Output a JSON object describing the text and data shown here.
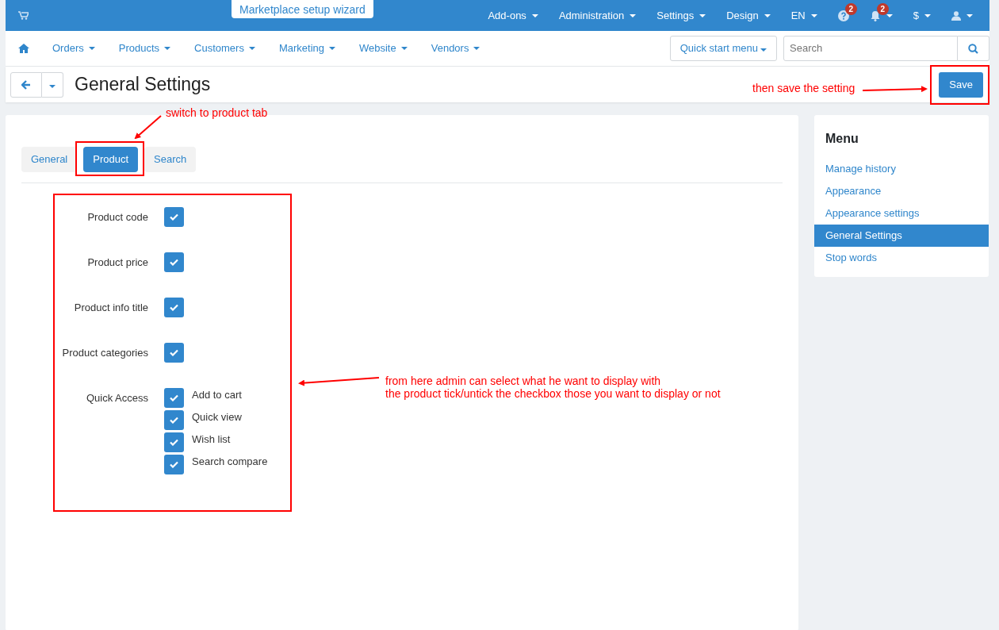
{
  "top_bar": {
    "wizard": "Marketplace setup wizard",
    "items": [
      {
        "kind": "text",
        "label": "Add-ons",
        "caret": true
      },
      {
        "kind": "text",
        "label": "Administration",
        "caret": true
      },
      {
        "kind": "text",
        "label": "Settings",
        "caret": true
      },
      {
        "kind": "text",
        "label": "Design",
        "caret": true
      },
      {
        "kind": "text",
        "label": "EN",
        "caret": true
      },
      {
        "kind": "help",
        "badge": "2",
        "caret": false
      },
      {
        "kind": "bell",
        "badge": "2",
        "caret": true
      },
      {
        "kind": "text",
        "label": "$",
        "caret": true
      },
      {
        "kind": "user",
        "caret": true
      }
    ]
  },
  "nav": {
    "items": [
      {
        "label": "Orders"
      },
      {
        "label": "Products"
      },
      {
        "label": "Customers"
      },
      {
        "label": "Marketing"
      },
      {
        "label": "Website"
      },
      {
        "label": "Vendors"
      }
    ],
    "quick_start": "Quick start menu",
    "search": {
      "placeholder": "Search"
    }
  },
  "page_title": "General Settings",
  "save_button": "Save",
  "tabs": [
    {
      "label": "General",
      "selected": false
    },
    {
      "label": "Product",
      "selected": true
    },
    {
      "label": "Search",
      "selected": false
    }
  ],
  "fields": [
    {
      "kind": "checkbox",
      "label": "Product code",
      "checked": true
    },
    {
      "kind": "checkbox",
      "label": "Product price",
      "checked": true
    },
    {
      "kind": "checkbox",
      "label": "Product info title",
      "checked": true
    },
    {
      "kind": "checkbox",
      "label": "Product categories",
      "checked": true
    },
    {
      "kind": "group",
      "label": "Quick Access",
      "options": [
        {
          "label": "Add to cart",
          "checked": true
        },
        {
          "label": "Quick view",
          "checked": true
        },
        {
          "label": "Wish list",
          "checked": true
        },
        {
          "label": "Search compare",
          "checked": true
        }
      ]
    }
  ],
  "menu": {
    "title": "Menu",
    "items": [
      {
        "label": "Manage history",
        "selected": false
      },
      {
        "label": "Appearance",
        "selected": false
      },
      {
        "label": "Appearance settings",
        "selected": false
      },
      {
        "label": "General Settings",
        "selected": true
      },
      {
        "label": "Stop words",
        "selected": false
      }
    ]
  },
  "annotations": [
    {
      "kind": "tab_note",
      "lines": [
        "switch to product tab"
      ]
    },
    {
      "kind": "save_note",
      "lines": [
        "then save the setting"
      ]
    },
    {
      "kind": "form_note",
      "lines": [
        "from here admin can select what he want to display with",
        "the product tick/untick the checkbox  those you want to display or not"
      ]
    }
  ]
}
